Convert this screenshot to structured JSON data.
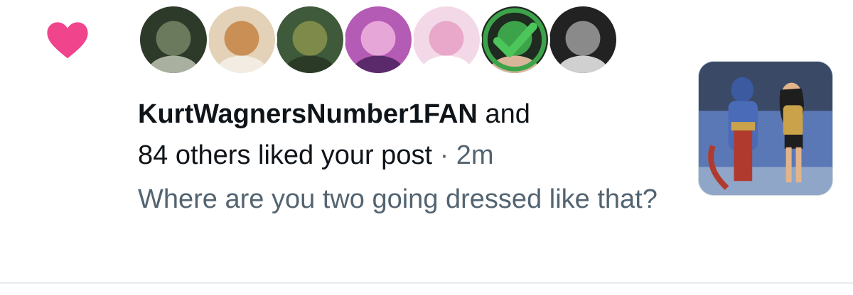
{
  "notification": {
    "type": "like",
    "icon": "heart-icon",
    "icon_color": "#f0448c",
    "user": "KurtWagnersNumber1FAN",
    "connector": " and",
    "others_text": "84 others liked your post",
    "separator": " · ",
    "time": "2m",
    "post_preview": "Where are you two going dressed like that?",
    "avatars": [
      {
        "name": "avatar-1",
        "colors": [
          "#2d3a2a",
          "#6b7a5c",
          "#a9b0a0"
        ]
      },
      {
        "name": "avatar-2",
        "colors": [
          "#e3d2b7",
          "#c98f55",
          "#f2ece2"
        ]
      },
      {
        "name": "avatar-3",
        "colors": [
          "#3f5a3a",
          "#7d8a4a",
          "#2b3a26"
        ]
      },
      {
        "name": "avatar-4",
        "colors": [
          "#b45bb5",
          "#e7a6d8",
          "#5a2a6a"
        ]
      },
      {
        "name": "avatar-5",
        "colors": [
          "#f3d9e8",
          "#e9a7c9",
          "#ffffff"
        ]
      },
      {
        "name": "avatar-6",
        "colors": [
          "#1f2a20",
          "#3da34a",
          "#d9b59a"
        ]
      },
      {
        "name": "avatar-7",
        "colors": [
          "#222222",
          "#8a8a8a",
          "#d0d0d0"
        ]
      }
    ],
    "thumbnail_colors": [
      "#3a4a66",
      "#5a78b5",
      "#b03a2e",
      "#c9a24a",
      "#1e1e1e"
    ]
  }
}
